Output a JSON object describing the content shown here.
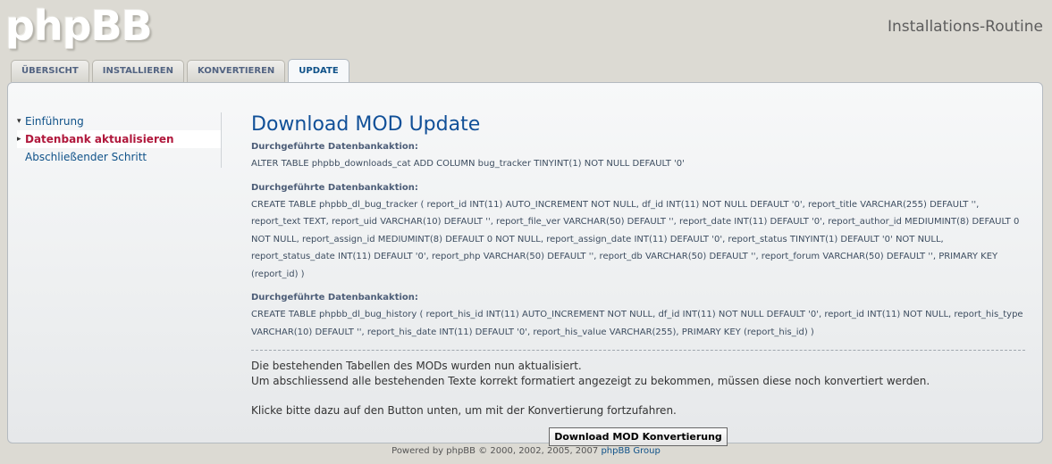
{
  "header": {
    "logo_text": "phpBB",
    "title": "Installations-Routine"
  },
  "tabs": [
    {
      "label": "ÜBERSICHT",
      "active": false
    },
    {
      "label": "INSTALLIEREN",
      "active": false
    },
    {
      "label": "KONVERTIEREN",
      "active": false
    },
    {
      "label": "UPDATE",
      "active": true
    }
  ],
  "sidebar": {
    "items": [
      {
        "label": "Einführung",
        "active": false
      },
      {
        "label": "Datenbank aktualisieren",
        "active": true
      },
      {
        "label": "Abschließender Schritt",
        "active": false
      }
    ]
  },
  "main": {
    "title": "Download MOD Update",
    "actions": [
      {
        "label": "Durchgeführte Datenbankaktion:",
        "sql": "ALTER TABLE phpbb_downloads_cat ADD COLUMN bug_tracker TINYINT(1) NOT NULL DEFAULT '0'"
      },
      {
        "label": "Durchgeführte Datenbankaktion:",
        "sql": "CREATE TABLE phpbb_dl_bug_tracker ( report_id INT(11) AUTO_INCREMENT NOT NULL, df_id INT(11) NOT NULL DEFAULT '0', report_title VARCHAR(255) DEFAULT '', report_text TEXT, report_uid VARCHAR(10) DEFAULT '', report_file_ver VARCHAR(50) DEFAULT '', report_date INT(11) DEFAULT '0', report_author_id MEDIUMINT(8) DEFAULT 0 NOT NULL, report_assign_id MEDIUMINT(8) DEFAULT 0 NOT NULL, report_assign_date INT(11) DEFAULT '0', report_status TINYINT(1) DEFAULT '0' NOT NULL, report_status_date INT(11) DEFAULT '0', report_php VARCHAR(50) DEFAULT '', report_db VARCHAR(50) DEFAULT '', report_forum VARCHAR(50) DEFAULT '', PRIMARY KEY (report_id) )"
      },
      {
        "label": "Durchgeführte Datenbankaktion:",
        "sql": "CREATE TABLE phpbb_dl_bug_history ( report_his_id INT(11) AUTO_INCREMENT NOT NULL, df_id INT(11) NOT NULL DEFAULT '0', report_id INT(11) NOT NULL, report_his_type VARCHAR(10) DEFAULT '', report_his_date INT(11) DEFAULT '0', report_his_value VARCHAR(255), PRIMARY KEY (report_his_id) )"
      }
    ],
    "message_line1": "Die bestehenden Tabellen des MODs wurden nun aktualisiert.",
    "message_line2": "Um abschliessend alle bestehenden Texte korrekt formatiert angezeigt zu bekommen, müssen diese noch konvertiert werden.",
    "message_line3": "Klicke bitte dazu auf den Button unten, um mit der Konvertierung fortzufahren.",
    "button_label": "Download MOD Konvertierung"
  },
  "footer": {
    "text": "Powered by phpBB © 2000, 2002, 2005, 2007",
    "link": "phpBB Group"
  },
  "colors": {
    "link": "#105289",
    "active_nav": "#b0183c",
    "heading": "#115098"
  }
}
